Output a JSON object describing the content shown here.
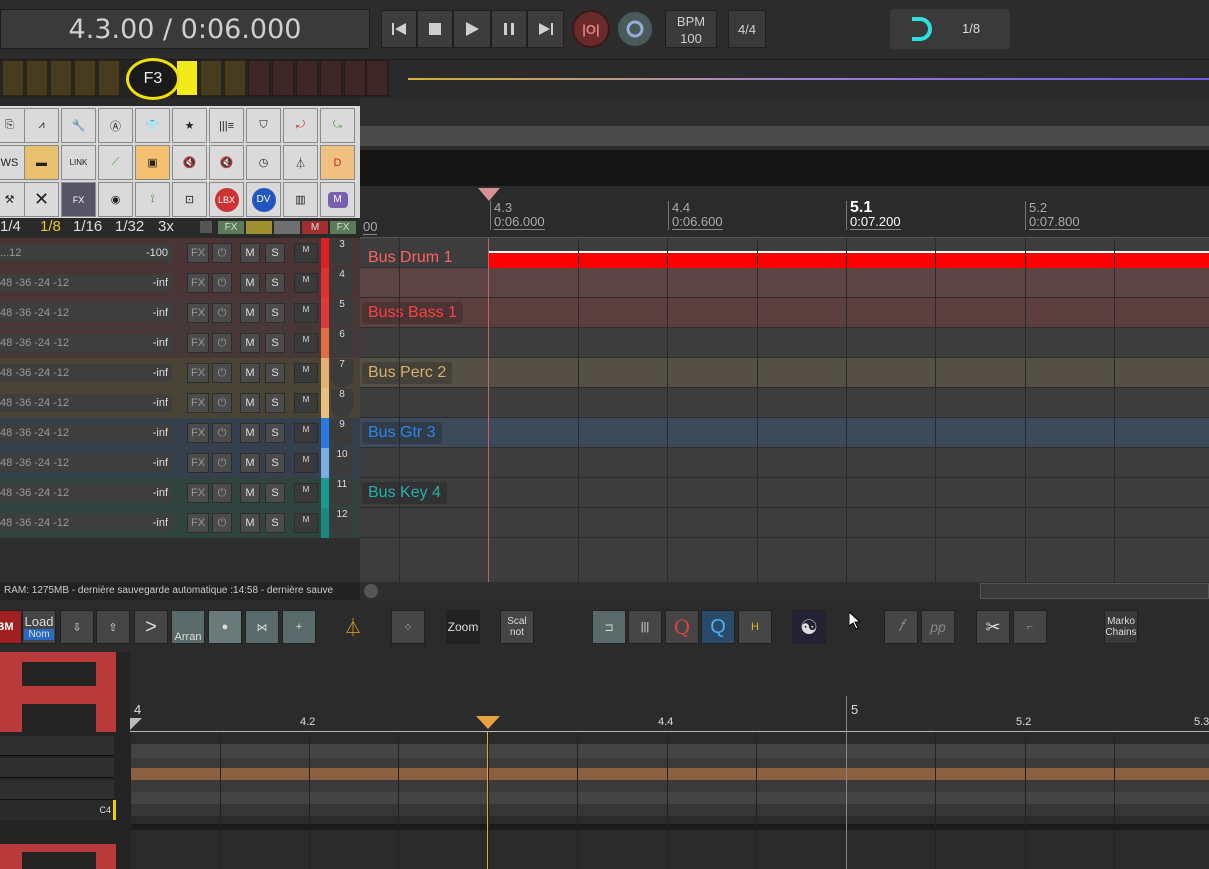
{
  "transport": {
    "time_display": "4.3.00 / 0:06.000",
    "bpm_label": "BPM",
    "bpm_value": "100",
    "time_signature": "4/4",
    "grid_value": "1/8"
  },
  "meter": {
    "key_note": "F3"
  },
  "grid_labels": {
    "g1": "1/4",
    "g2": "1/8",
    "g3": "1/16",
    "g4": "1/32",
    "g5": "3x",
    "fx1": "FX",
    "m": "M",
    "fx2": "FX"
  },
  "ruler": {
    "marks": [
      {
        "bar": "",
        "time": "00"
      },
      {
        "bar": "4.3",
        "time": "0:06.000"
      },
      {
        "bar": "4.4",
        "time": "0:06.600"
      },
      {
        "bar": "5.1",
        "time": "0:07.200"
      },
      {
        "bar": "5.2",
        "time": "0:07.800"
      }
    ]
  },
  "tracks": [
    {
      "num": "3",
      "value": "-100",
      "scale": "...12",
      "color": "#e02020",
      "bus": "Bus Drum 1",
      "lane_color": "#ff0000",
      "label_color": "#ff6060"
    },
    {
      "num": "4",
      "value": "-inf",
      "scale": "48  -36  -24  -12",
      "color": "#e03030",
      "bus": "",
      "lane_color": "#5c4444",
      "label_color": ""
    },
    {
      "num": "5",
      "value": "-inf",
      "scale": "48  -36  -24  -12",
      "color": "#e03838",
      "bus": "Buss Bass 1",
      "lane_color": "#5c4040",
      "label_color": "#ff4040"
    },
    {
      "num": "6",
      "value": "-inf",
      "scale": "48  -36  -24  -12",
      "color": "#e07040",
      "bus": "",
      "lane_color": "#3d3d3d",
      "label_color": ""
    },
    {
      "num": "7",
      "value": "-inf",
      "scale": "48  -36  -24  -12",
      "color": "#e8b070",
      "bus": "Bus Perc 2",
      "lane_color": "#545046",
      "label_color": "#d8b070"
    },
    {
      "num": "8",
      "value": "-inf",
      "scale": "48  -36  -24  -12",
      "color": "#e8c080",
      "bus": "",
      "lane_color": "#3d3d3d",
      "label_color": ""
    },
    {
      "num": "9",
      "value": "-inf",
      "scale": "48  -36  -24  -12",
      "color": "#2a7ae0",
      "bus": "Bus Gtr 3",
      "lane_color": "#3c4a5a",
      "label_color": "#2f86e8"
    },
    {
      "num": "10",
      "value": "-inf",
      "scale": "48  -36  -24  -12",
      "color": "#7ab0e8",
      "bus": "",
      "lane_color": "#3d3d3d",
      "label_color": ""
    },
    {
      "num": "11",
      "value": "-inf",
      "scale": "48  -36  -24  -12",
      "color": "#1a9a90",
      "bus": "Bus Key 4",
      "lane_color": "#3d3d3d",
      "label_color": "#22b0b0"
    },
    {
      "num": "12",
      "value": "-inf",
      "scale": "48  -36  -24  -12",
      "color": "#1a8a80",
      "bus": "",
      "lane_color": "#3d3d3d",
      "label_color": ""
    }
  ],
  "track_buttons": {
    "fx": "FX",
    "mute": "M",
    "solo": "S",
    "m_small": "M"
  },
  "status": {
    "text": "RAM: 1275MB -  dernière sauvegarde automatique :14:58 -  dernière sauve"
  },
  "lower_toolbar": {
    "load": "Load",
    "nom": "Nom",
    "arrange": "Arran",
    "zoom": "Zoom",
    "scale": "Scal",
    "scale2": "not",
    "h": "H",
    "marko": "Marko",
    "chains": "Chains",
    "bm": "BM"
  },
  "piano_roll": {
    "note_label": "C4",
    "ruler": [
      "4",
      "4.2",
      "4.4",
      "5",
      "5.2",
      "5.3"
    ]
  }
}
